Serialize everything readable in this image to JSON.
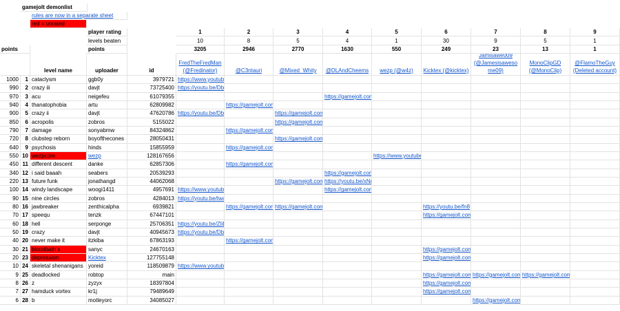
{
  "title": "gamejolt demonlist",
  "rules_link": "rules are now in a separate sheet",
  "legend_red": "red = unrated",
  "labels": {
    "player_rating": "player rating",
    "levels_beaten": "levels beaten",
    "points_col": "points",
    "points_row": "points",
    "level_name": "level name",
    "uploader": "uploader",
    "id": "id"
  },
  "players": [
    {
      "rating": "1",
      "beaten": "10",
      "points": "3205",
      "name": "FredTheFredMan (@Fredinator)"
    },
    {
      "rating": "2",
      "beaten": "8",
      "points": "2946",
      "name": "@C3ntauri"
    },
    {
      "rating": "3",
      "beaten": "5",
      "points": "2770",
      "name": "@Mixed_Whity"
    },
    {
      "rating": "4",
      "beaten": "4",
      "points": "1630",
      "name": "@DLAndCheems"
    },
    {
      "rating": "5",
      "beaten": "1",
      "points": "550",
      "name": "wezp (@w4z)"
    },
    {
      "rating": "6",
      "beaten": "30",
      "points": "249",
      "name": "Kicktex (@kicktex)"
    },
    {
      "rating": "7",
      "beaten": "9",
      "points": "23",
      "name": "Jamisawe009 (@Jamesisaweso me09)"
    },
    {
      "rating": "8",
      "beaten": "5",
      "points": "13",
      "name": "MonoClipGD (@MonoClip)"
    },
    {
      "rating": "9",
      "beaten": "1",
      "points": "1",
      "name": "@FlamoTheGuy (Deleted account)"
    }
  ],
  "levels": [
    {
      "points": "1000",
      "rank": "1",
      "name": "cataclysm",
      "uploader": "ggb0y",
      "id": "3979721",
      "red": false,
      "uploader_link": false,
      "links": {
        "0": "https://www.youtube"
      }
    },
    {
      "points": "990",
      "rank": "2",
      "name": "crazy iii",
      "uploader": "davjt",
      "id": "73725400",
      "red": false,
      "uploader_link": false,
      "links": {
        "0": "https://youtu.be/Dbv"
      }
    },
    {
      "points": "970",
      "rank": "3",
      "name": "acu",
      "uploader": "neigefeu",
      "id": "61079355",
      "red": false,
      "uploader_link": false,
      "links": {
        "3": "https://gamejolt.com"
      }
    },
    {
      "points": "940",
      "rank": "4",
      "name": "thanatophobia",
      "uploader": "artu",
      "id": "62809982",
      "red": false,
      "uploader_link": false,
      "links": {
        "1": "https://gamejolt.com"
      }
    },
    {
      "points": "900",
      "rank": "5",
      "name": "crazy ii",
      "uploader": "davjt",
      "id": "47620786",
      "red": false,
      "uploader_link": false,
      "links": {
        "0": "https://youtu.be/Dbv",
        "2": "https://gamejolt.com"
      }
    },
    {
      "points": "850",
      "rank": "6",
      "name": "acropolis",
      "uploader": "zobros",
      "id": "5155022",
      "red": false,
      "uploader_link": false,
      "links": {
        "2": "https://gamejolt.com"
      }
    },
    {
      "points": "790",
      "rank": "7",
      "name": "damage",
      "uploader": "sonyabmw",
      "id": "84324862",
      "red": false,
      "uploader_link": false,
      "links": {
        "1": "https://gamejolt.com"
      }
    },
    {
      "points": "720",
      "rank": "8",
      "name": "clubstep reborn",
      "uploader": "boyofthecones",
      "id": "28050431",
      "red": false,
      "uploader_link": false,
      "links": {
        "2": "https://gamejolt.com"
      }
    },
    {
      "points": "640",
      "rank": "9",
      "name": "psychosis",
      "uploader": "hinds",
      "id": "15855959",
      "red": false,
      "uploader_link": false,
      "links": {
        "1": "https://gamejolt.com"
      }
    },
    {
      "points": "550",
      "rank": "10",
      "name": "wezpcore",
      "uploader": "wezp",
      "id": "128167656",
      "red": true,
      "uploader_link": true,
      "links": {
        "4": "https://www.youtube"
      }
    },
    {
      "points": "450",
      "rank": "11",
      "name": "different descent",
      "uploader": "danke",
      "id": "62857306",
      "red": false,
      "uploader_link": false,
      "links": {
        "1": "https://gamejolt.com"
      }
    },
    {
      "points": "340",
      "rank": "12",
      "name": "i said baaah",
      "uploader": "seabers",
      "id": "20539293",
      "red": false,
      "uploader_link": false,
      "links": {
        "3": "https://gamejolt.com"
      }
    },
    {
      "points": "220",
      "rank": "13",
      "name": "future funk",
      "uploader": "jonathangd",
      "id": "44062068",
      "red": false,
      "uploader_link": false,
      "links": {
        "2": "https://gamejolt.com",
        "3": "https://youtu.be/xNr"
      }
    },
    {
      "points": "100",
      "rank": "14",
      "name": "windy landscape",
      "uploader": "woogi1411",
      "id": "4957691",
      "red": false,
      "uploader_link": false,
      "links": {
        "0": "https://www.youtube",
        "3": "https://gamejolt.com"
      }
    },
    {
      "points": "90",
      "rank": "15",
      "name": "nine circles",
      "uploader": "zobros",
      "id": "4284013",
      "red": false,
      "uploader_link": false,
      "links": {
        "0": "https://youtu.be/twa"
      }
    },
    {
      "points": "80",
      "rank": "16",
      "name": "jawbreaker",
      "uploader": "zenthicalpha",
      "id": "6939821",
      "red": false,
      "uploader_link": false,
      "links": {
        "1": "https://gamejolt.com",
        "2": "https://gamejolt.com",
        "5": "https://youtu.be/fn8"
      }
    },
    {
      "points": "70",
      "rank": "17",
      "name": "speequ",
      "uploader": "tenzk",
      "id": "67447101",
      "red": false,
      "uploader_link": false,
      "links": {
        "5": "https://gamejolt.com"
      }
    },
    {
      "points": "60",
      "rank": "18",
      "name": "hell",
      "uploader": "serponge",
      "id": "25706351",
      "red": false,
      "uploader_link": false,
      "links": {
        "0": "https://youtu.be/ZliD"
      }
    },
    {
      "points": "50",
      "rank": "19",
      "name": "crazy",
      "uploader": "davjt",
      "id": "40945673",
      "red": false,
      "uploader_link": false,
      "links": {
        "0": "https://youtu.be/Dbv"
      }
    },
    {
      "points": "40",
      "rank": "20",
      "name": "never make it",
      "uploader": "itzkiba",
      "id": "67863193",
      "red": false,
      "uploader_link": false,
      "links": {
        "1": "https://gamejolt.com"
      }
    },
    {
      "points": "30",
      "rank": "21",
      "name": "bloodbath x",
      "uploader": "sanyc",
      "id": "24670163",
      "red": true,
      "uploader_link": false,
      "links": {
        "5": "https://gamejolt.com"
      }
    },
    {
      "points": "20",
      "rank": "23",
      "name": "depression",
      "uploader": "Kicktex",
      "id": "127755148",
      "red": true,
      "uploader_link": true,
      "links": {
        "5": "https://gamejolt.com"
      }
    },
    {
      "points": "10",
      "rank": "24",
      "name": "skeletal shenanigans",
      "uploader": "yoreid",
      "id": "118509879",
      "red": false,
      "uploader_link": false,
      "links": {
        "0": "https://www.youtube"
      }
    },
    {
      "points": "9",
      "rank": "25",
      "name": "deadlocked",
      "uploader": "robtop",
      "id": "main",
      "red": false,
      "uploader_link": false,
      "links": {
        "5": "https://gamejolt.com",
        "6": "https://gamejolt.com",
        "7": "https://gamejolt.com"
      }
    },
    {
      "points": "8",
      "rank": "26",
      "name": "z",
      "uploader": "zyzyx",
      "id": "18397804",
      "red": false,
      "uploader_link": false,
      "links": {
        "5": "https://gamejolt.com"
      }
    },
    {
      "points": "7",
      "rank": "27",
      "name": "hamduck vortex",
      "uploader": "kr1j",
      "id": "79489649",
      "red": false,
      "uploader_link": false,
      "links": {
        "5": "https://gamejolt.com"
      }
    },
    {
      "points": "6",
      "rank": "28",
      "name": "b",
      "uploader": "motleyorc",
      "id": "34085027",
      "red": false,
      "uploader_link": false,
      "links": {
        "6": "https://gamejolt.com"
      }
    }
  ]
}
